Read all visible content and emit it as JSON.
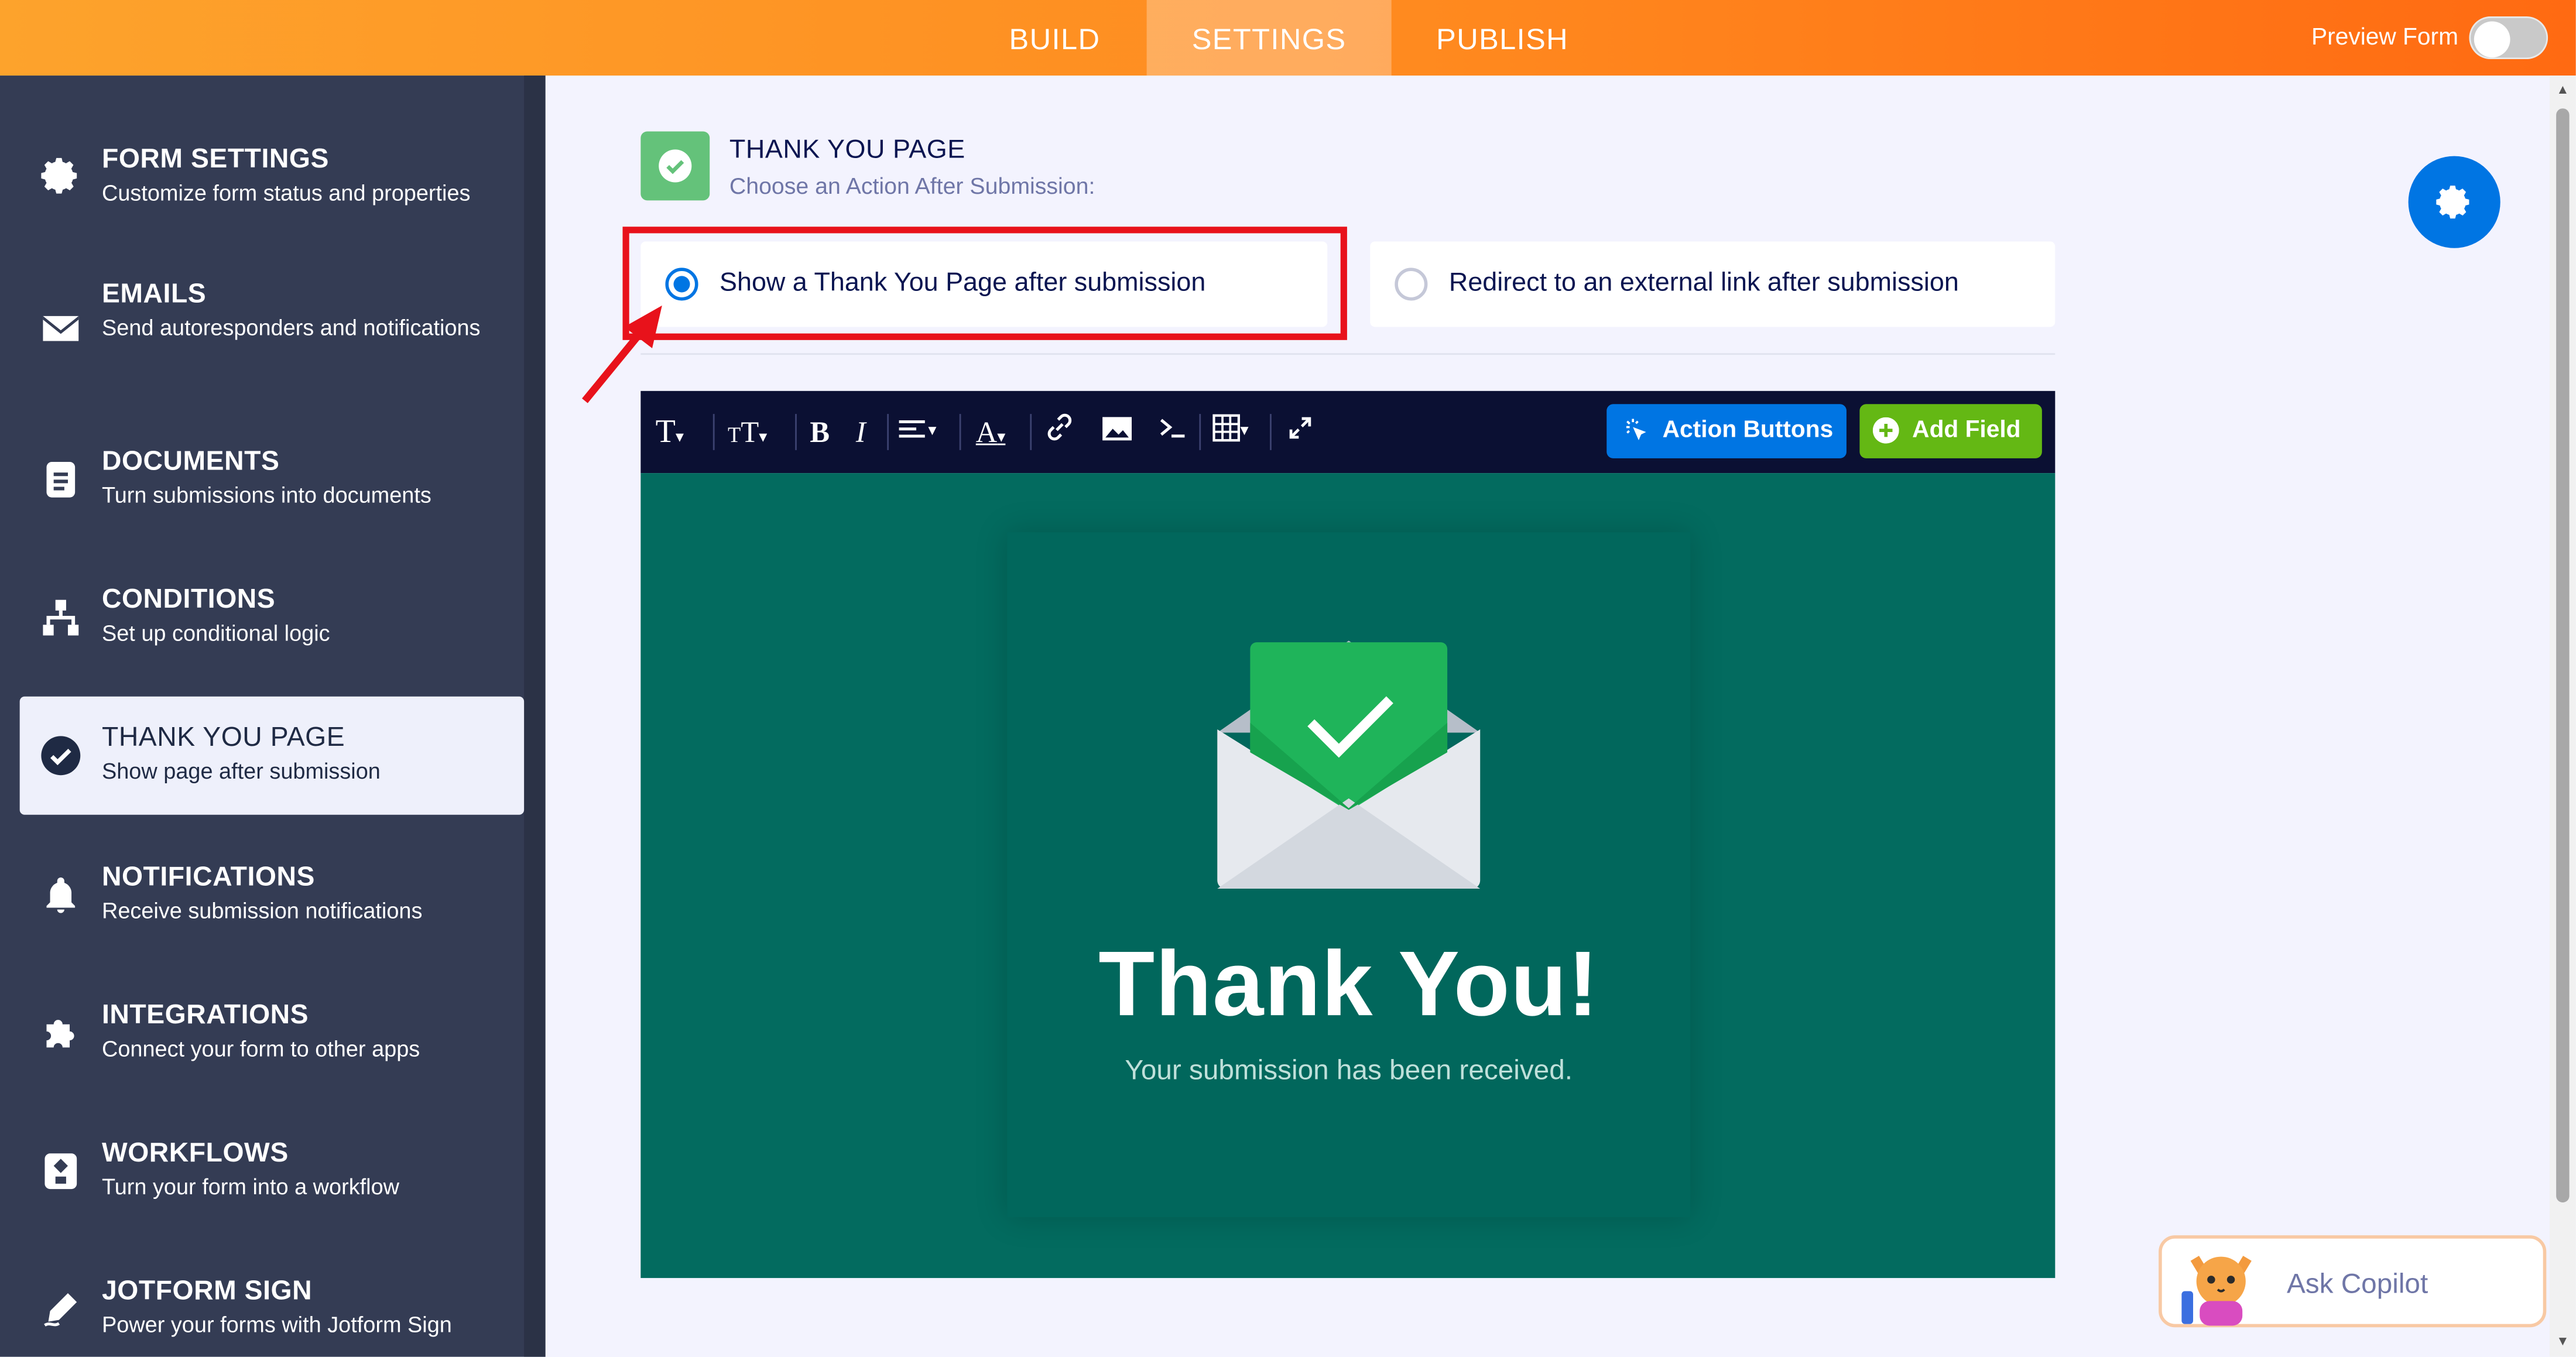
{
  "topbar": {
    "tabs": [
      {
        "label": "BUILD"
      },
      {
        "label": "SETTINGS"
      },
      {
        "label": "PUBLISH"
      }
    ],
    "active_tab": "SETTINGS",
    "preview_label": "Preview Form",
    "preview_on": false
  },
  "sidebar": {
    "items": [
      {
        "title": "FORM SETTINGS",
        "desc": "Customize form status and properties",
        "icon": "gear-icon"
      },
      {
        "title": "EMAILS",
        "desc": "Send autoresponders and notifications",
        "icon": "envelope-icon"
      },
      {
        "title": "DOCUMENTS",
        "desc": "Turn submissions into documents",
        "icon": "document-icon"
      },
      {
        "title": "CONDITIONS",
        "desc": "Set up conditional logic",
        "icon": "sitemap-icon"
      },
      {
        "title": "THANK YOU PAGE",
        "desc": "Show page after submission",
        "icon": "check-circle-icon"
      },
      {
        "title": "NOTIFICATIONS",
        "desc": "Receive submission notifications",
        "icon": "bell-icon"
      },
      {
        "title": "INTEGRATIONS",
        "desc": "Connect your form to other apps",
        "icon": "puzzle-icon"
      },
      {
        "title": "WORKFLOWS",
        "desc": "Turn your form into a workflow",
        "icon": "workflow-icon"
      },
      {
        "title": "JOTFORM SIGN",
        "desc": "Power your forms with Jotform Sign",
        "icon": "pen-icon"
      }
    ],
    "active_index": 4
  },
  "main": {
    "title": "THANK YOU PAGE",
    "subtitle": "Choose an Action After Submission:",
    "options": [
      {
        "label": "Show a Thank You Page after submission",
        "selected": true
      },
      {
        "label": "Redirect to an external link after submission",
        "selected": false
      }
    ]
  },
  "editor": {
    "action_buttons_label": "Action Buttons",
    "add_field_label": "Add Field",
    "thank_you_title": "Thank You!",
    "thank_you_subtitle": "Your submission has been received."
  },
  "copilot": {
    "label": "Ask Copilot"
  },
  "colors": {
    "accent": "#0075e3",
    "orange": "#ff8a1f",
    "sidebar": "#343c54",
    "canvas": "#036b5f",
    "success": "#1fb45a",
    "highlight": "#e8121b"
  }
}
